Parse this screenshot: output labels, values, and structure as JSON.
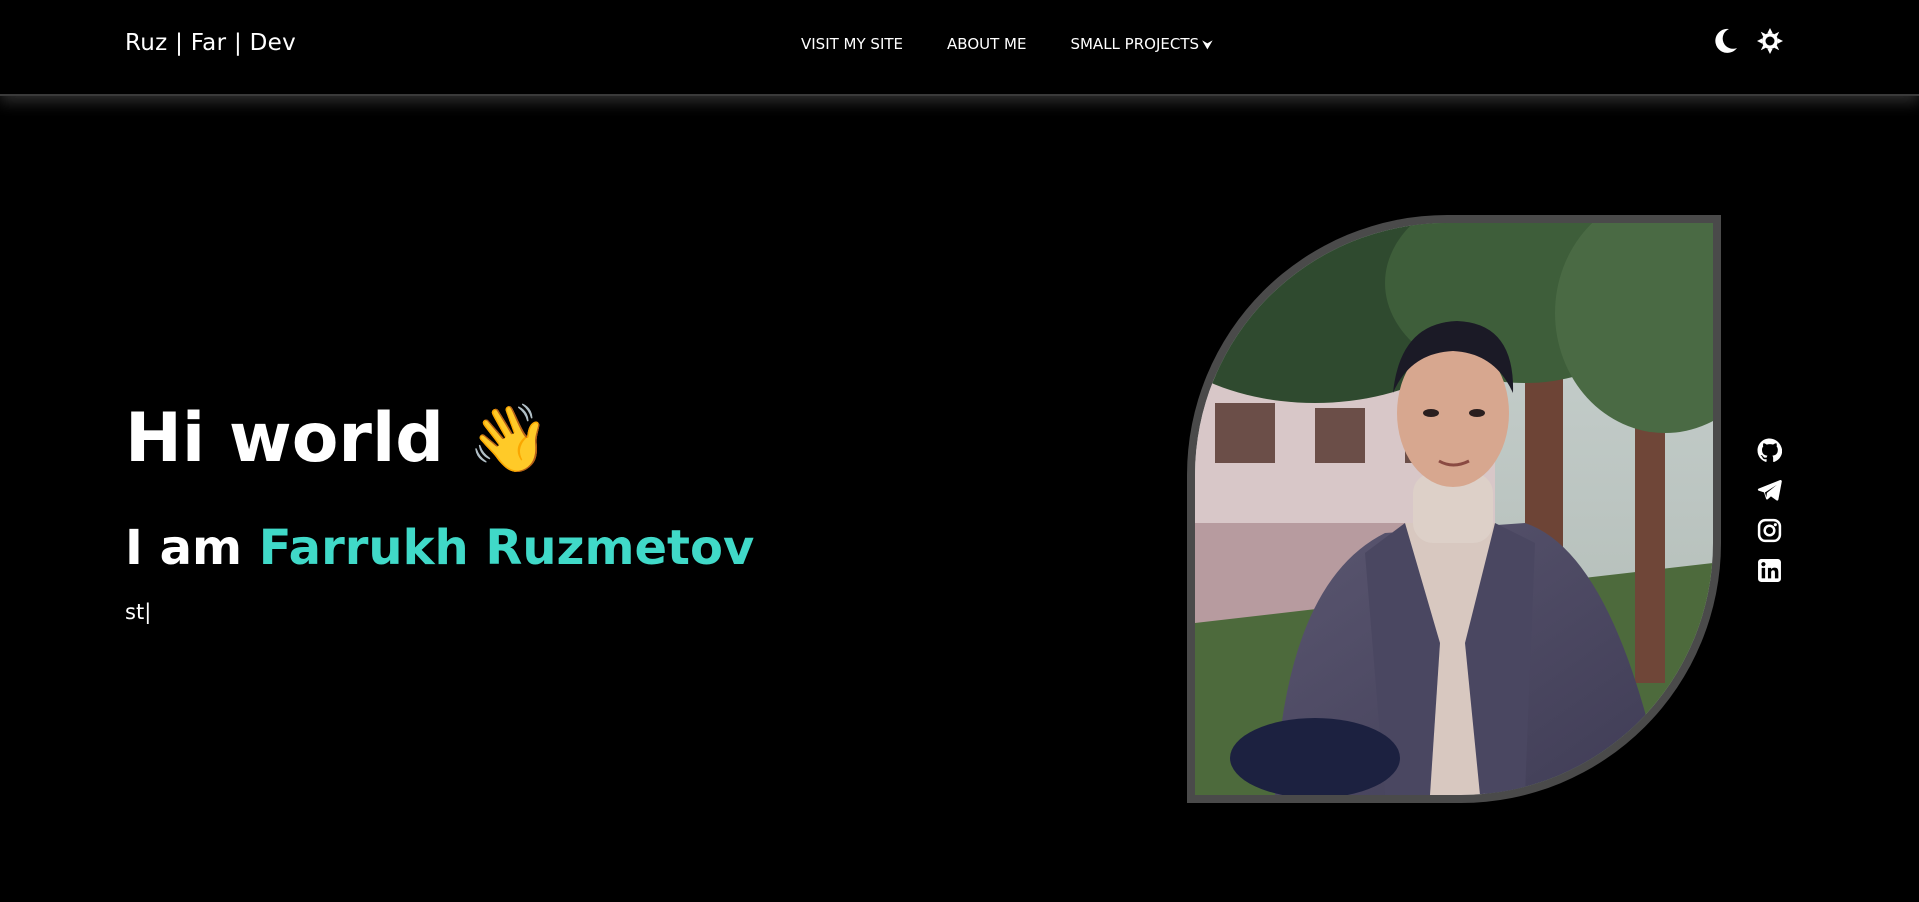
{
  "brand": "Ruz | Far | Dev",
  "nav": [
    {
      "label": "VISIT MY SITE"
    },
    {
      "label": "ABOUT ME"
    },
    {
      "label": "SMALL PROJECTS",
      "chevron": "⮟"
    }
  ],
  "theme": {
    "moon_icon": "moon-icon",
    "sun_icon": "sun-icon"
  },
  "hero": {
    "greeting": "Hi world",
    "wave": "👋",
    "intro": "I am",
    "name": "Farrukh Ruzmetov",
    "typed_text": "st",
    "cursor": "|"
  },
  "photo": {
    "alt_icon": "profile-photo"
  },
  "socials": [
    {
      "icon": "github-icon"
    },
    {
      "icon": "telegram-icon"
    },
    {
      "icon": "instagram-icon"
    },
    {
      "icon": "linkedin-icon"
    }
  ],
  "colors": {
    "background": "#000000",
    "accent": "#40d9c8",
    "text": "#ffffff"
  }
}
